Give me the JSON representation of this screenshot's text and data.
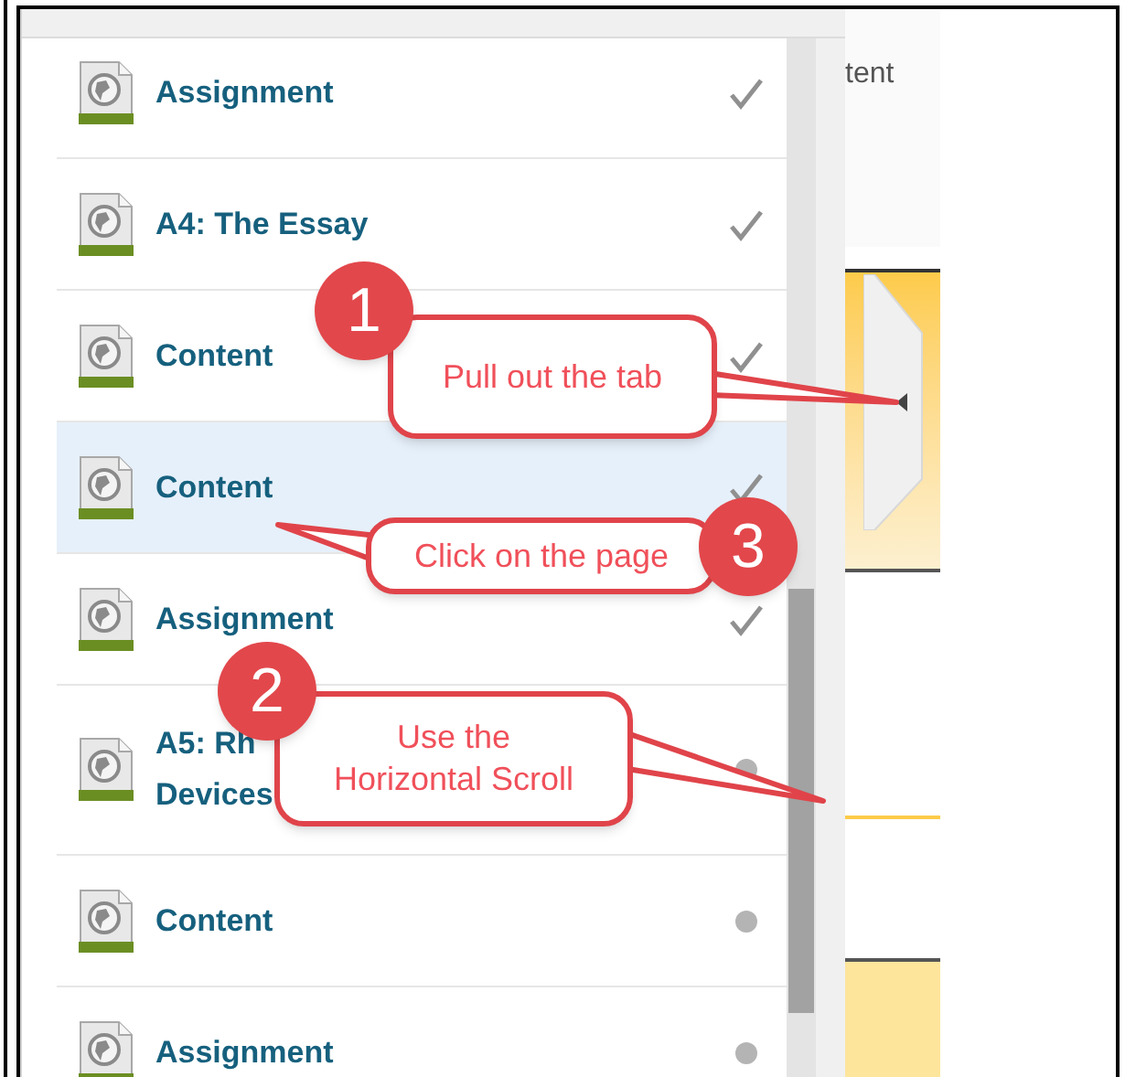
{
  "items": [
    {
      "lines": [
        "Assignment"
      ],
      "done": true,
      "selected": false
    },
    {
      "lines": [
        "A4: The Essay"
      ],
      "done": true,
      "selected": false
    },
    {
      "lines": [
        "Content"
      ],
      "done": true,
      "selected": false
    },
    {
      "lines": [
        "Content"
      ],
      "done": true,
      "selected": true
    },
    {
      "lines": [
        "Assignment"
      ],
      "done": true,
      "selected": false
    },
    {
      "lines": [
        "A5: Rh",
        "Devices"
      ],
      "done": false,
      "selected": false
    },
    {
      "lines": [
        "Content"
      ],
      "done": false,
      "selected": false
    },
    {
      "lines": [
        "Assignment"
      ],
      "done": false,
      "selected": false
    }
  ],
  "page_text": "tent",
  "callouts": [
    {
      "number": "1",
      "lines": [
        "Pull out the tab"
      ]
    },
    {
      "number": "3",
      "lines": [
        "Click on the page"
      ]
    },
    {
      "number": "2",
      "lines": [
        "Use the",
        "Horizontal Scroll"
      ]
    }
  ]
}
